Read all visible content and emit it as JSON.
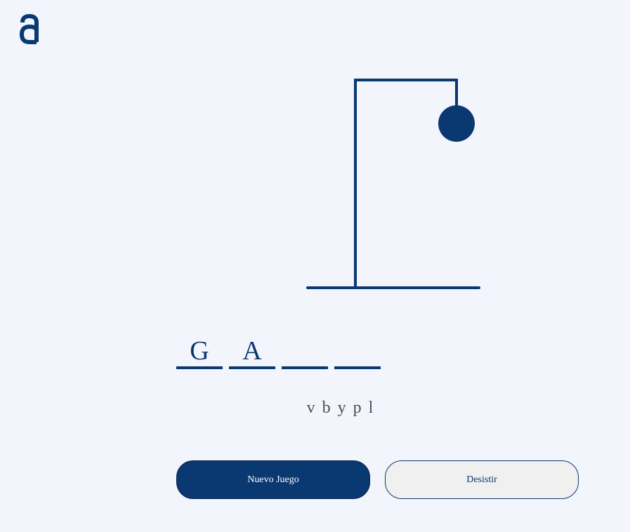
{
  "brand": {
    "logo_icon": "alura-a-logo-icon",
    "color": "#0A3871"
  },
  "game": {
    "word_letters": [
      "G",
      "A",
      "",
      ""
    ],
    "wrong_letters": [
      "v",
      "b",
      "y",
      "p",
      "l"
    ],
    "parts_drawn": [
      "base",
      "pole",
      "beam",
      "rope",
      "head"
    ]
  },
  "buttons": {
    "new_game": "Nuevo Juego",
    "give_up": "Desistir"
  },
  "colors": {
    "background": "#F3F5FC",
    "primary": "#0A3871",
    "wrong_letters_text": "#495057",
    "secondary_button_bg": "#F0F0F0"
  }
}
